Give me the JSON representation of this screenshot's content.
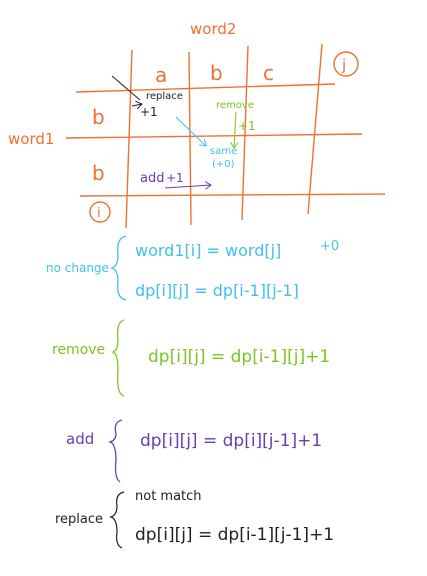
{
  "colors": {
    "grid": "#f07030",
    "no_change": "#3fc0ef",
    "remove": "#7cc420",
    "add": "#6a3db0",
    "replace": "#222222"
  },
  "grid": {
    "column_header": "word2",
    "row_header": "word1",
    "columns": [
      "a",
      "b",
      "c"
    ],
    "rows": [
      "b",
      "b"
    ],
    "column_index": "j",
    "row_index": "i",
    "annotations": {
      "replace": {
        "label": "replace",
        "cost": "+1"
      },
      "same": {
        "label": "same",
        "cost": "(+0)"
      },
      "remove": {
        "label": "remove",
        "cost": "+1"
      },
      "add": {
        "label": "add",
        "cost": "+1"
      }
    }
  },
  "rules": [
    {
      "name": "no change",
      "lines": [
        "word1[i] = word[j]",
        "dp[i][j] = dp[i-1][j-1]"
      ],
      "cost": "+0"
    },
    {
      "name": "remove",
      "lines": [
        "dp[i][j] = dp[i-1][j]+1"
      ]
    },
    {
      "name": "add",
      "lines": [
        "dp[i][j] = dp[i][j-1]+1"
      ]
    },
    {
      "name": "replace",
      "lines": [
        "not match",
        "dp[i][j] = dp[i-1][j-1]+1"
      ]
    }
  ]
}
